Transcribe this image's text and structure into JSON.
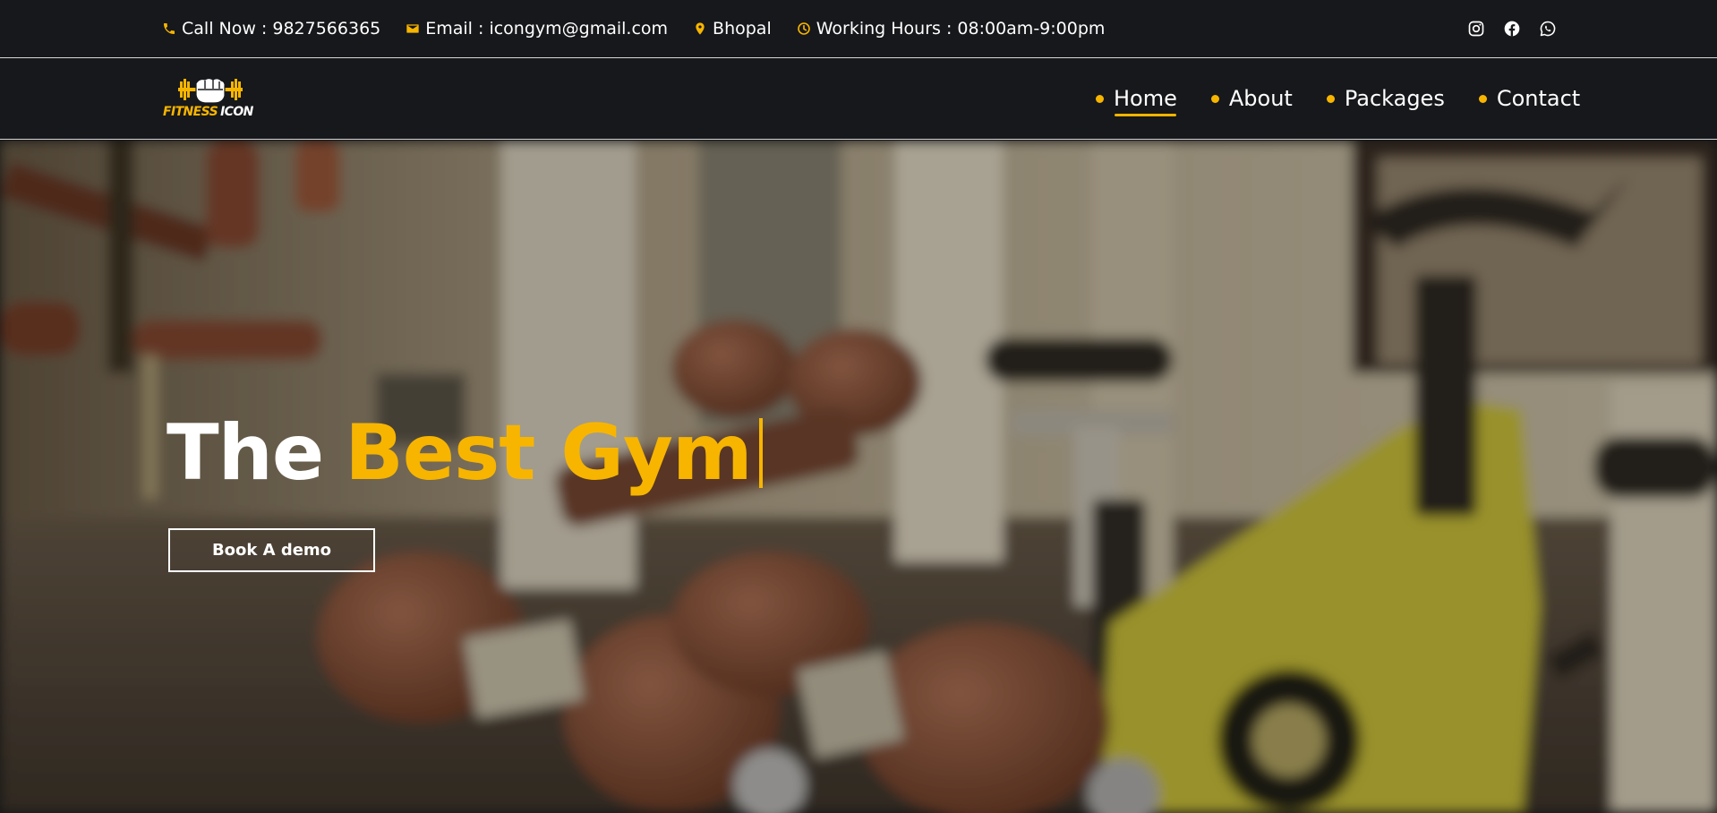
{
  "colors": {
    "accent": "#f7b500",
    "background": "#17181b",
    "text": "#ffffff"
  },
  "topbar": {
    "phone": {
      "icon": "phone-icon",
      "text": "Call Now : 9827566365"
    },
    "email": {
      "icon": "mail-icon",
      "text": "Email : icongym@gmail.com"
    },
    "location": {
      "icon": "map-pin-icon",
      "text": "Bhopal"
    },
    "hours": {
      "icon": "clock-icon",
      "text": "Working Hours : 08:00am-9:00pm"
    },
    "social": [
      "instagram-icon",
      "facebook-icon",
      "whatsapp-icon"
    ]
  },
  "logo": {
    "word1": "FITNESS",
    "word2": "ICON"
  },
  "nav": {
    "items": [
      {
        "label": "Home",
        "active": true
      },
      {
        "label": "About",
        "active": false
      },
      {
        "label": "Packages",
        "active": false
      },
      {
        "label": "Contact",
        "active": false
      }
    ]
  },
  "hero": {
    "headline_white": "The",
    "headline_accent": "Best Gym",
    "cta_label": "Book A demo"
  }
}
